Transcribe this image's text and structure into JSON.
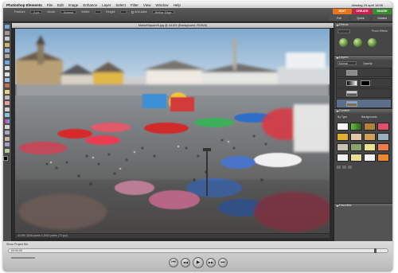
{
  "menubar": {
    "app_name": "Photoshop Elements",
    "items": [
      "File",
      "Edit",
      "Image",
      "Enhance",
      "Layer",
      "Select",
      "Filter",
      "View",
      "Window",
      "Help"
    ],
    "clock": "dinsdag 29 april 18:56"
  },
  "options_bar": {
    "feather_label": "Feather:",
    "feather_value": "0 px",
    "mode_label": "Mode:",
    "mode_value": "Normal",
    "width_label": "Width:",
    "height_label": "Height:",
    "antialias_label": "Anti-alias",
    "refine_label": "Refine Edge"
  },
  "mode_tabs": {
    "edit": "EDIT",
    "create": "CREATE",
    "share": "SHARE"
  },
  "sub_tabs": {
    "full": "Full",
    "quick": "Quick",
    "guided": "Guided"
  },
  "document": {
    "title": "MarketSquare5.jpg @ 44.8% (Background, RGB/8)",
    "status": "44.8%   3008 pixels x 2000 pixels (72 ppi)"
  },
  "panels": {
    "effects": {
      "title": "Effects",
      "filter_label": "Photo Effects"
    },
    "layers": {
      "title": "Layers",
      "mode": "Normal",
      "opacity_label": "Opacity:"
    },
    "content": {
      "title": "Content",
      "by_type": "By Type",
      "category": "Backgrounds"
    },
    "favorites": {
      "title": "Favorites"
    }
  },
  "dock": {
    "project_bin": "Show Project Bin",
    "timecode": "00:00:00"
  },
  "transport": {
    "rewind": "⏮",
    "back": "◀◀",
    "play": "▶",
    "forward": "▶▶",
    "end": "⏭"
  },
  "colors": {
    "edit_tab": "#e8751a",
    "create_tab": "#c8234f",
    "share_tab": "#3a8e2f",
    "panel_bg": "#535353"
  }
}
